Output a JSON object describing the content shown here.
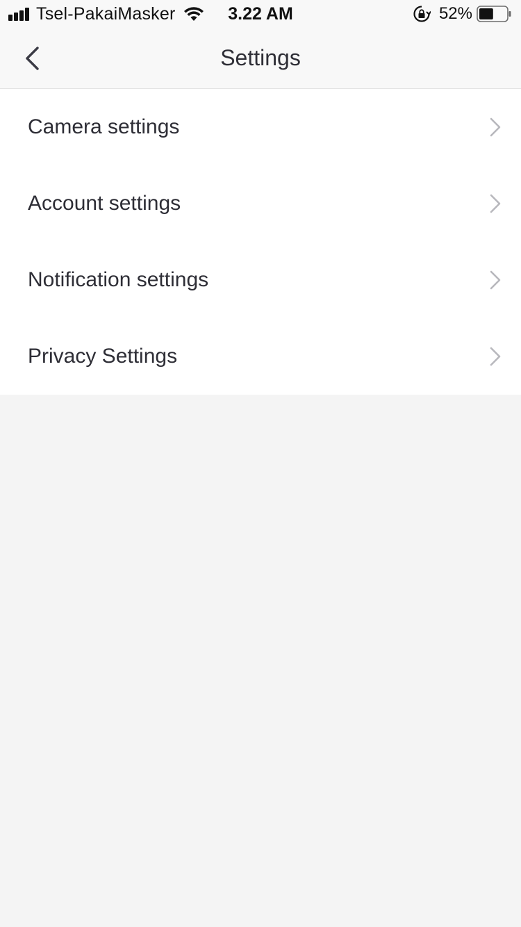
{
  "status_bar": {
    "carrier": "Tsel-PakaiMasker",
    "time": "3.22 AM",
    "battery_percent": "52%",
    "battery_level": 0.52,
    "signal_bars": 4
  },
  "nav": {
    "title": "Settings",
    "back_icon": "chevron-left-icon"
  },
  "settings": {
    "items": [
      {
        "label": "Camera settings"
      },
      {
        "label": "Account settings"
      },
      {
        "label": "Notification settings"
      },
      {
        "label": "Privacy Settings"
      }
    ]
  },
  "colors": {
    "text": "#2e2e36",
    "chevron": "#b8b8bd",
    "background": "#f4f4f4",
    "list_background": "#ffffff",
    "bar_background": "#f8f8f8"
  }
}
